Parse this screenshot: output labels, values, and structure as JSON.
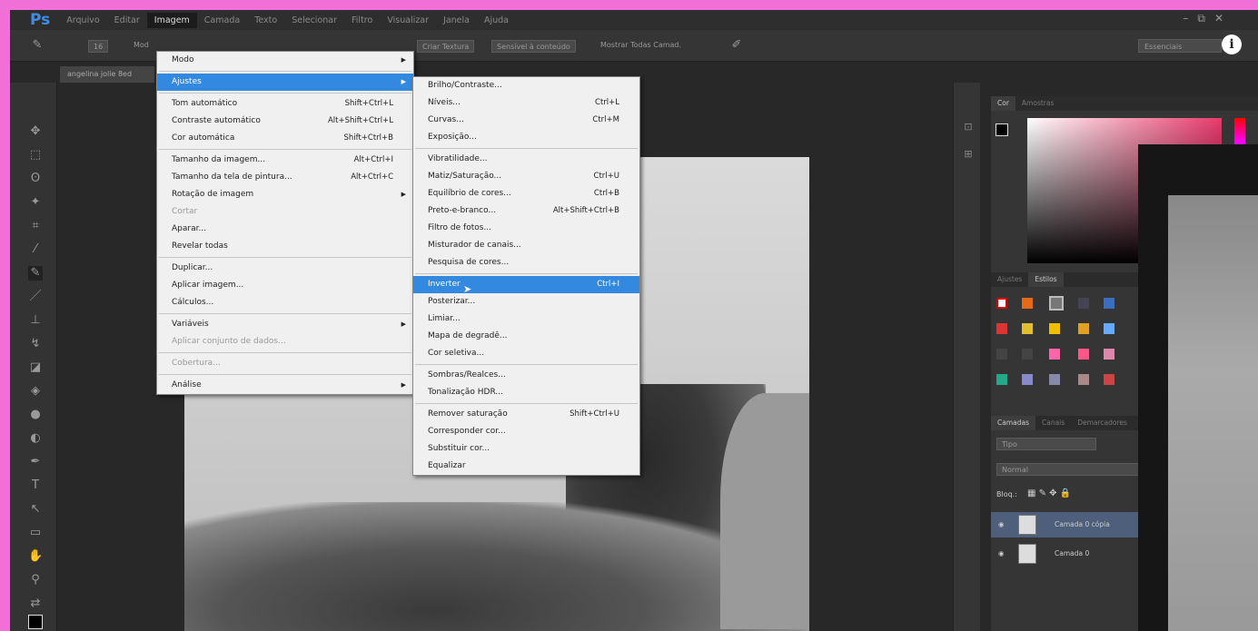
{
  "app": {
    "logo": "Ps",
    "document_tab": "angelina jolie 8ed"
  },
  "menubar": [
    "Arquivo",
    "Editar",
    "Imagem",
    "Camada",
    "Texto",
    "Selecionar",
    "Filtro",
    "Visualizar",
    "Janela",
    "Ajuda"
  ],
  "window_controls": {
    "minimize": "–",
    "restore": "⧉",
    "close": "✕"
  },
  "options_bar": {
    "brush_size": "16",
    "mode_label": "Mod",
    "create_texture": "Criar Textura",
    "content_aware": "Sensível à conteúdo",
    "sample_all": "Mostrar Todas Camad.",
    "workspace": "Essenciais"
  },
  "image_menu": {
    "groups": [
      [
        {
          "label": "Modo",
          "arrow": "▶"
        }
      ],
      [
        {
          "label": "Ajustes",
          "arrow": "▶",
          "highlight": true
        }
      ],
      [
        {
          "label": "Tom automático",
          "shortcut": "Shift+Ctrl+L"
        },
        {
          "label": "Contraste automático",
          "shortcut": "Alt+Shift+Ctrl+L"
        },
        {
          "label": "Cor automática",
          "shortcut": "Shift+Ctrl+B"
        }
      ],
      [
        {
          "label": "Tamanho da imagem...",
          "shortcut": "Alt+Ctrl+I"
        },
        {
          "label": "Tamanho da tela de pintura...",
          "shortcut": "Alt+Ctrl+C"
        },
        {
          "label": "Rotação de imagem",
          "arrow": "▶"
        },
        {
          "label": "Cortar",
          "disabled": true
        },
        {
          "label": "Aparar..."
        },
        {
          "label": "Revelar todas"
        }
      ],
      [
        {
          "label": "Duplicar..."
        },
        {
          "label": "Aplicar imagem..."
        },
        {
          "label": "Cálculos..."
        }
      ],
      [
        {
          "label": "Variáveis",
          "arrow": "▶"
        },
        {
          "label": "Aplicar conjunto de dados...",
          "disabled": true
        }
      ],
      [
        {
          "label": "Cobertura...",
          "disabled": true
        }
      ],
      [
        {
          "label": "Análise",
          "arrow": "▶"
        }
      ]
    ]
  },
  "adjustments_menu": {
    "groups": [
      [
        {
          "label": "Brilho/Contraste..."
        },
        {
          "label": "Níveis...",
          "shortcut": "Ctrl+L"
        },
        {
          "label": "Curvas...",
          "shortcut": "Ctrl+M"
        },
        {
          "label": "Exposição..."
        }
      ],
      [
        {
          "label": "Vibratilidade..."
        },
        {
          "label": "Matiz/Saturação...",
          "shortcut": "Ctrl+U"
        },
        {
          "label": "Equilíbrio de cores...",
          "shortcut": "Ctrl+B"
        },
        {
          "label": "Preto-e-branco...",
          "shortcut": "Alt+Shift+Ctrl+B"
        },
        {
          "label": "Filtro de fotos..."
        },
        {
          "label": "Misturador de canais..."
        },
        {
          "label": "Pesquisa de cores..."
        }
      ],
      [
        {
          "label": "Inverter",
          "shortcut": "Ctrl+I",
          "highlight": true
        },
        {
          "label": "Posterizar..."
        },
        {
          "label": "Limiar..."
        },
        {
          "label": "Mapa de degradê..."
        },
        {
          "label": "Cor seletiva..."
        }
      ],
      [
        {
          "label": "Sombras/Realces..."
        },
        {
          "label": "Tonalização HDR..."
        }
      ],
      [
        {
          "label": "Remover saturação",
          "shortcut": "Shift+Ctrl+U"
        },
        {
          "label": "Corresponder cor..."
        },
        {
          "label": "Substituir cor..."
        },
        {
          "label": "Equalizar"
        }
      ]
    ]
  },
  "panels": {
    "color_tabs": [
      "Cor",
      "Amostras"
    ],
    "styles_tabs": [
      "Ajustes",
      "Estilos"
    ],
    "layers_tabs": [
      "Camadas",
      "Canais",
      "Demarcadores"
    ],
    "kind_filter": "Tipo",
    "blend_mode": "Normal",
    "lock_label": "Bloq.:",
    "layers": [
      {
        "name": "Camada 0 cópia",
        "selected": true
      },
      {
        "name": "Camada 0",
        "selected": false
      }
    ]
  },
  "colors": {
    "accent": "#3389e0",
    "frame": "#f070d8"
  }
}
